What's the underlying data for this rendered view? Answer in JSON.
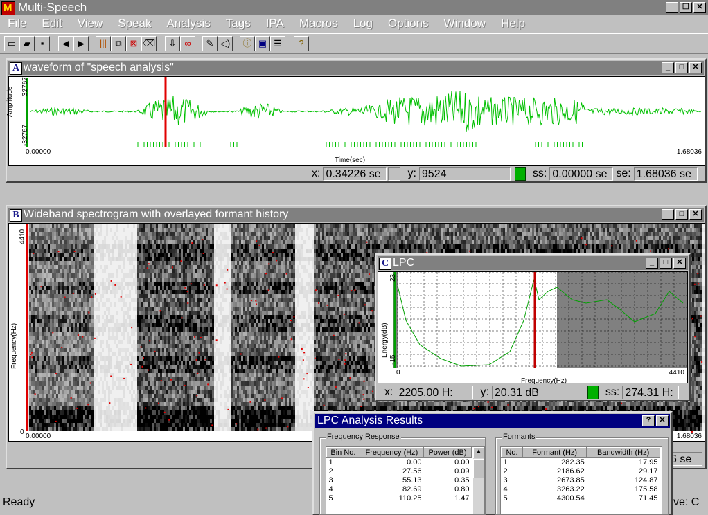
{
  "app": {
    "title": "Multi-Speech"
  },
  "menu": [
    "File",
    "Edit",
    "View",
    "Speak",
    "Analysis",
    "Tags",
    "IPA",
    "Macros",
    "Log",
    "Options",
    "Window",
    "Help"
  ],
  "waveform": {
    "letter": "A",
    "title": "waveform of \"speech analysis\"",
    "ylabel": "Amplitude",
    "ymax": "32767",
    "ymin": "-32767",
    "xstart": "0.00000",
    "xend": "1.68036",
    "xlabel": "Time(sec)",
    "color": "#00c000",
    "cursor_color": "#e00000",
    "status": {
      "x_label": "x:",
      "x_value": "0.34226 se",
      "y_label": "y:",
      "y_value": "9524",
      "ss_label": "ss:",
      "ss_value": "0.00000 se",
      "se_label": "se:",
      "se_value": "1.68036 se"
    }
  },
  "spectrogram": {
    "letter": "B",
    "title": "Wideband spectrogram with overlayed formant history",
    "ylabel": "Frequency(Hz)",
    "ymax": "4410",
    "ymin": "0",
    "xstart": "0.00000",
    "xend": "1.68036",
    "status_partial_x": "x",
    "status_partial_se": "6 se"
  },
  "lpc": {
    "letter": "C",
    "title": "LPC",
    "ylabel": "Energy(dB)",
    "ymax": "23",
    "ymin": "-15",
    "xmin": "0",
    "xmax": "4410",
    "xlabel": "Frequency(Hz)",
    "status": {
      "x_label": "x:",
      "x_value": "2205.00 H:",
      "y_label": "y:",
      "y_value": "20.31 dB",
      "ss_label": "ss:",
      "ss_value": "274.31 H:"
    }
  },
  "results": {
    "title": "LPC Analysis Results",
    "freq_group": "Frequency Response",
    "freq_headers": [
      "Bin No.",
      "Frequency (Hz)",
      "Power (dB)"
    ],
    "freq_rows": [
      [
        "1",
        "0.00",
        "0.00"
      ],
      [
        "2",
        "27.56",
        "0.09"
      ],
      [
        "3",
        "55.13",
        "0.35"
      ],
      [
        "4",
        "82.69",
        "0.80"
      ],
      [
        "5",
        "110.25",
        "1.47"
      ]
    ],
    "formant_group": "Formants",
    "formant_headers": [
      "No.",
      "Formant (Hz)",
      "Bandwidth (Hz)"
    ],
    "formant_rows": [
      [
        "1",
        "282.35",
        "17.95"
      ],
      [
        "2",
        "2186.62",
        "29.17"
      ],
      [
        "3",
        "2673.85",
        "124.87"
      ],
      [
        "4",
        "3263.22",
        "175.58"
      ],
      [
        "5",
        "4300.54",
        "71.45"
      ]
    ]
  },
  "statusbar": {
    "left": "Ready",
    "right": "ctive: C"
  }
}
